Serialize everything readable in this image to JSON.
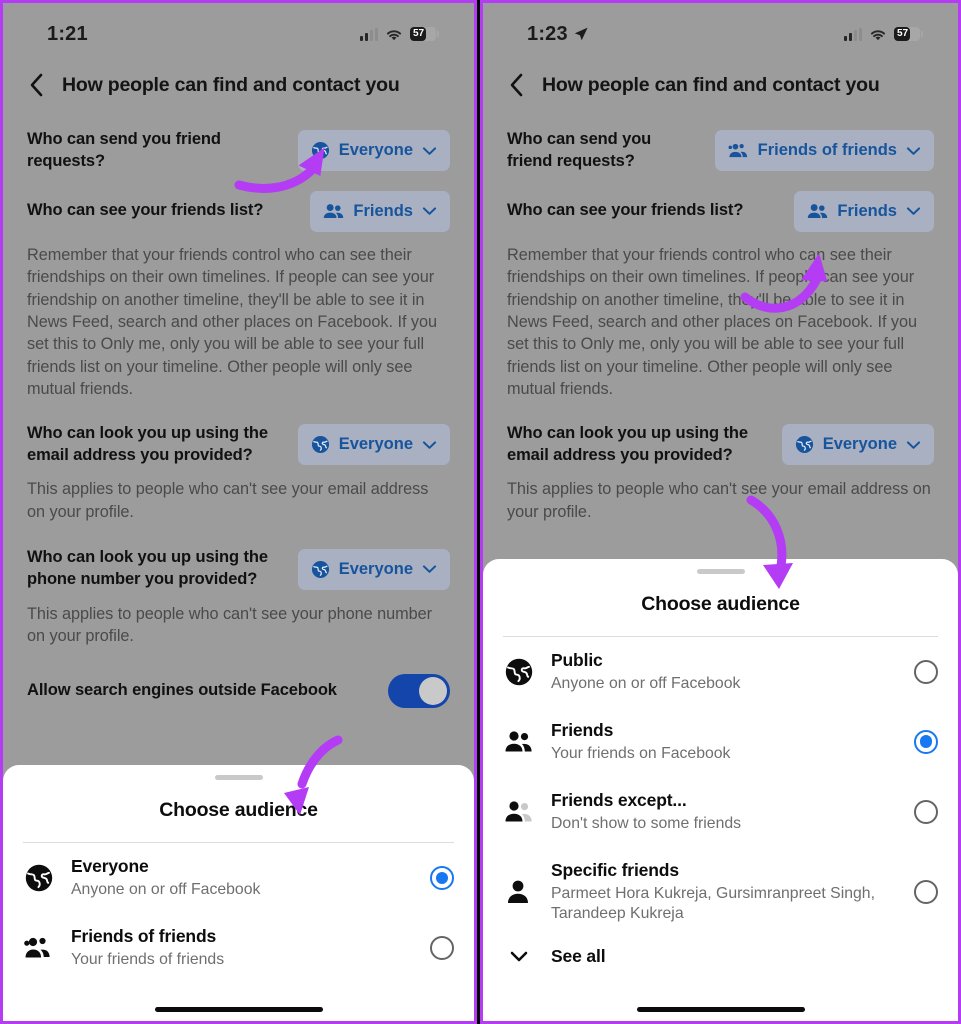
{
  "panels": [
    {
      "status": {
        "time": "1:21",
        "has_location_arrow": false,
        "battery": "57"
      },
      "nav": {
        "title": "How people can find and contact you",
        "back_icon": "chevron-left-icon"
      },
      "settings": [
        {
          "label": "Who can send you friend requests?",
          "value": "Everyone",
          "icon": "globe-icon"
        },
        {
          "label": "Who can see your friends list?",
          "value": "Friends",
          "icon": "friends-icon"
        }
      ],
      "friends_list_description": "Remember that your friends control who can see their friendships on their own timelines. If people can see your friendship on another timeline, they'll be able to see it in News Feed, search and other places on Facebook. If you set this to Only me, only you will be able to see your full friends list on your timeline. Other people will only see mutual friends.",
      "email_lookup": {
        "label": "Who can look you up using the email address you provided?",
        "value": "Everyone",
        "icon": "globe-icon",
        "description": "This applies to people who can't see your email address on your profile."
      },
      "phone_lookup": {
        "label": "Who can look you up using the phone number you provided?",
        "value": "Everyone",
        "icon": "globe-icon",
        "description": "This applies to people who can't see your phone number on your profile."
      },
      "search_engines": {
        "label": "Allow search engines outside Facebook",
        "toggle_on": true
      },
      "sheet": {
        "title": "Choose audience",
        "options": [
          {
            "title": "Everyone",
            "subtitle": "Anyone on or off Facebook",
            "icon": "globe-icon",
            "selected": true
          },
          {
            "title": "Friends of friends",
            "subtitle": "Your friends of friends",
            "icon": "friends-of-friends-icon",
            "selected": false
          }
        ]
      }
    },
    {
      "status": {
        "time": "1:23",
        "has_location_arrow": true,
        "battery": "57"
      },
      "nav": {
        "title": "How people can find and contact you",
        "back_icon": "chevron-left-icon"
      },
      "settings": [
        {
          "label": "Who can send you friend requests?",
          "value": "Friends of friends",
          "icon": "friends-of-friends-icon"
        },
        {
          "label": "Who can see your friends list?",
          "value": "Friends",
          "icon": "friends-icon"
        }
      ],
      "friends_list_description": "Remember that your friends control who can see their friendships on their own timelines. If people can see your friendship on another timeline, they'll be able to see it in News Feed, search and other places on Facebook. If you set this to Only me, only you will be able to see your full friends list on your timeline. Other people will only see mutual friends.",
      "email_lookup": {
        "label": "Who can look you up using the email address you provided?",
        "value": "Everyone",
        "icon": "globe-icon",
        "description": "This applies to people who can't see your email address on your profile."
      },
      "sheet": {
        "title": "Choose audience",
        "options": [
          {
            "title": "Public",
            "subtitle": "Anyone on or off Facebook",
            "icon": "globe-icon",
            "selected": false
          },
          {
            "title": "Friends",
            "subtitle": "Your friends on Facebook",
            "icon": "friends-icon",
            "selected": true
          },
          {
            "title": "Friends except...",
            "subtitle": "Don't show to some friends",
            "icon": "friends-except-icon",
            "selected": false
          },
          {
            "title": "Specific friends",
            "subtitle": "Parmeet Hora Kukreja, Gursimranpreet Singh, Tarandeep Kukreja",
            "icon": "person-icon",
            "selected": false
          }
        ],
        "see_all": {
          "label": "See all",
          "icon": "chevron-down-icon"
        }
      }
    }
  ],
  "colors": {
    "annotation_arrow": "#b43cf5",
    "panel_border": "#b43cf5",
    "pill_background": "#a8b0c2",
    "pill_text": "#17549c",
    "radio_selected": "#1877f2",
    "toggle_on": "#1345ab",
    "screen_background": "#9c9c9c"
  }
}
